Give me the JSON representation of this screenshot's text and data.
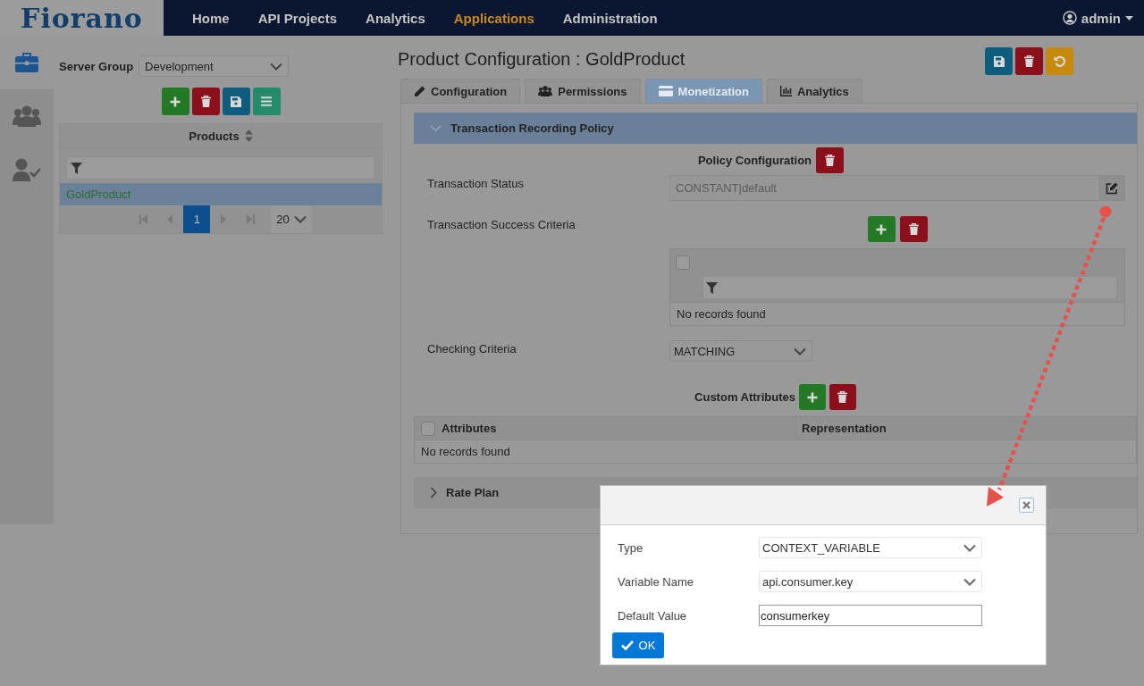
{
  "nav": {
    "logo": "Fiorano",
    "items": [
      {
        "label": "Home",
        "selected": false
      },
      {
        "label": "API Projects",
        "selected": false
      },
      {
        "label": "Analytics",
        "selected": false
      },
      {
        "label": "Applications",
        "selected": true
      },
      {
        "label": "Administration",
        "selected": false
      }
    ],
    "user": "admin"
  },
  "sidebar": {
    "items": [
      {
        "kind": "briefcase",
        "selected": true
      },
      {
        "kind": "users",
        "selected": false
      },
      {
        "kind": "user-check",
        "selected": false
      }
    ]
  },
  "server_group": {
    "label": "Server Group",
    "value": "Development"
  },
  "products": {
    "header": "Products",
    "rows": [
      {
        "name": "GoldProduct",
        "selected": true
      }
    ],
    "pager": {
      "page": "1",
      "page_size": "20"
    }
  },
  "main": {
    "title": "Product Configuration : GoldProduct",
    "tabs": [
      {
        "label": "Configuration",
        "kind": "pencil",
        "selected": false
      },
      {
        "label": "Permissions",
        "kind": "users",
        "selected": false
      },
      {
        "label": "Monetization",
        "kind": "card",
        "selected": true
      },
      {
        "label": "Analytics",
        "kind": "chart",
        "selected": false
      }
    ],
    "policy_section": {
      "title": "Transaction Recording Policy",
      "expanded": true
    },
    "policy": {
      "heading": "Policy Configuration",
      "transaction_status": {
        "label": "Transaction Status",
        "value": "CONSTANT|default"
      },
      "success_criteria": {
        "label": "Transaction Success Criteria",
        "select_all_checked": false,
        "empty": "No records found"
      },
      "checking_criteria": {
        "label": "Checking Criteria",
        "value": "MATCHING"
      },
      "custom_attributes": {
        "heading": "Custom Attributes",
        "select_all_checked": false,
        "columns": [
          "Attributes",
          "Representation"
        ],
        "empty": "No records found"
      }
    },
    "rate_plan_section": {
      "title": "Rate Plan",
      "expanded": false
    }
  },
  "dialog": {
    "fields": [
      {
        "label": "Type",
        "kind": "select",
        "value": "CONTEXT_VARIABLE"
      },
      {
        "label": "Variable Name",
        "kind": "select",
        "value": "api.consumer.key"
      },
      {
        "label": "Default Value",
        "kind": "text",
        "value": "consumerkey"
      }
    ],
    "ok": "OK"
  }
}
